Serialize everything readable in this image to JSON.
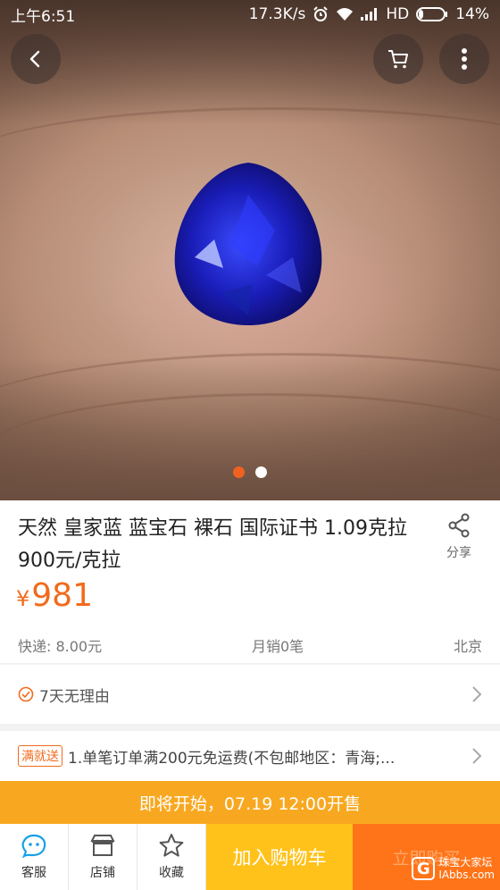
{
  "status_bar": {
    "time": "上午6:51",
    "speed": "17.3K/s",
    "network": "HD",
    "battery": "14%"
  },
  "gallery": {
    "page_count": 2,
    "active_index": 0
  },
  "product": {
    "title": "天然 皇家蓝 蓝宝石 裸石 国际证书 1.09克拉 900元/克拉",
    "share_label": "分享",
    "currency": "¥",
    "price": "981",
    "shipping": "快递: 8.00元",
    "monthly_sales": "月销0笔",
    "location": "北京"
  },
  "service": {
    "return_policy": "7天无理由"
  },
  "promo": {
    "badge": "满就送",
    "text": "1.单笔订单满200元免运费(不包邮地区：青海;..."
  },
  "sale_notice": "即将开始，07.19 12:00开售",
  "bottom_bar": {
    "service_label": "客服",
    "shop_label": "店铺",
    "favorite_label": "收藏",
    "add_to_cart_label": "加入购物车",
    "buy_now_label": "立即购买",
    "watermark": {
      "logo_letter": "G",
      "line1": "珠宝大家坛",
      "line2": "IAbbs.com"
    }
  },
  "colors": {
    "accent_price": "#f26a1b",
    "sale_bar": "#f8a820",
    "cart_button": "#ffc21a",
    "buy_button": "#ff7418"
  },
  "icons": {
    "back": "back-arrow-icon",
    "cart": "cart-icon",
    "more": "more-vertical-icon",
    "share": "share-icon",
    "check": "check-circle-icon",
    "chevron": "chevron-right-icon",
    "service": "chat-bubble-icon",
    "shop": "store-icon",
    "favorite": "star-icon"
  }
}
